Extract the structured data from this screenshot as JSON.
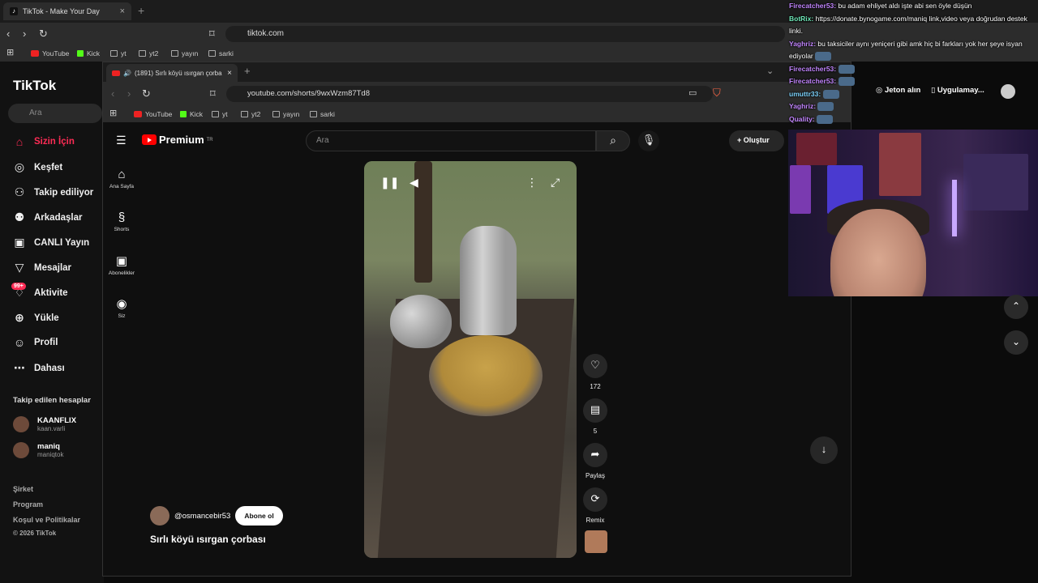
{
  "outer_browser": {
    "tab_title": "TikTok - Make Your Day",
    "url": "tiktok.com",
    "bookmarks": [
      "YouTube",
      "Kick",
      "yt",
      "yt2",
      "yayın",
      "sarki"
    ]
  },
  "tiktok": {
    "logo": "TikTok",
    "search_placeholder": "Ara",
    "nav": [
      {
        "label": "Sizin İçin",
        "icon": "home-icon"
      },
      {
        "label": "Keşfet",
        "icon": "compass-icon"
      },
      {
        "label": "Takip ediliyor",
        "icon": "user-plus-icon"
      },
      {
        "label": "Arkadaşlar",
        "icon": "users-icon"
      },
      {
        "label": "CANLI Yayın",
        "icon": "live-icon"
      },
      {
        "label": "Mesajlar",
        "icon": "send-icon"
      },
      {
        "label": "Aktivite",
        "icon": "bell-icon",
        "badge": "99+"
      },
      {
        "label": "Yükle",
        "icon": "upload-icon"
      },
      {
        "label": "Profil",
        "icon": "profile-icon"
      },
      {
        "label": "Dahası",
        "icon": "more-icon"
      }
    ],
    "followed_header": "Takip edilen hesaplar",
    "followed": [
      {
        "name": "KAANFLIX",
        "handle": "kaan.varli"
      },
      {
        "name": "maniq",
        "handle": "maniqtok"
      }
    ],
    "footer": [
      "Şirket",
      "Program",
      "Koşul ve Politikalar",
      "© 2026 TikTok"
    ]
  },
  "inner_browser": {
    "tab_title": "(1891) Sırlı köyü ısırgan çorba",
    "url": "youtube.com/shorts/9wxWzm87Td8",
    "bookmarks": [
      "YouTube",
      "Kick",
      "yt",
      "yt2",
      "yayın",
      "sarki"
    ]
  },
  "youtube": {
    "logo": "Premium",
    "region": "TR",
    "search_placeholder": "Ara",
    "create_label": "Oluştur",
    "sidebar": [
      {
        "label": "Ana Sayfa",
        "icon": "home-icon"
      },
      {
        "label": "Shorts",
        "icon": "shorts-icon"
      },
      {
        "label": "Abonelikler",
        "icon": "subscriptions-icon"
      },
      {
        "label": "Siz",
        "icon": "account-icon"
      }
    ],
    "short": {
      "likes": "172",
      "comments": "5",
      "share_label": "Paylaş",
      "remix_label": "Remix",
      "channel": "@osmancebir53",
      "subscribe_label": "Abone ol",
      "title": "Sırlı köyü ısırgan çorbası"
    }
  },
  "stream_overlay": {
    "chat": [
      {
        "user": "Firecatcher53:",
        "color": "#c084fc",
        "text": " bu adam ehliyet aldı işte abi sen öyle düşün"
      },
      {
        "user": "BotRix:",
        "color": "#6ee7b7",
        "text": " https://donate.bynogame.com/maniq link,video veya doğrudan destek linki."
      },
      {
        "user": "Yaghriz:",
        "color": "#c084fc",
        "text": " bu taksiciler aynı yeniçeri gibi amk hiç bi farkları yok her şeye isyan ediyolar"
      },
      {
        "user": "Firecatcher53:",
        "color": "#c084fc",
        "text": ""
      },
      {
        "user": "Firecatcher53:",
        "color": "#c084fc",
        "text": ""
      },
      {
        "user": "umuttr33:",
        "color": "#7dd3fc",
        "text": ""
      },
      {
        "user": "Yaghriz:",
        "color": "#c084fc",
        "text": ""
      },
      {
        "user": "Quality:",
        "color": "#c084fc",
        "text": ""
      }
    ],
    "jeton_label": "Jeton alın",
    "app_label": "Uygulamay..."
  }
}
